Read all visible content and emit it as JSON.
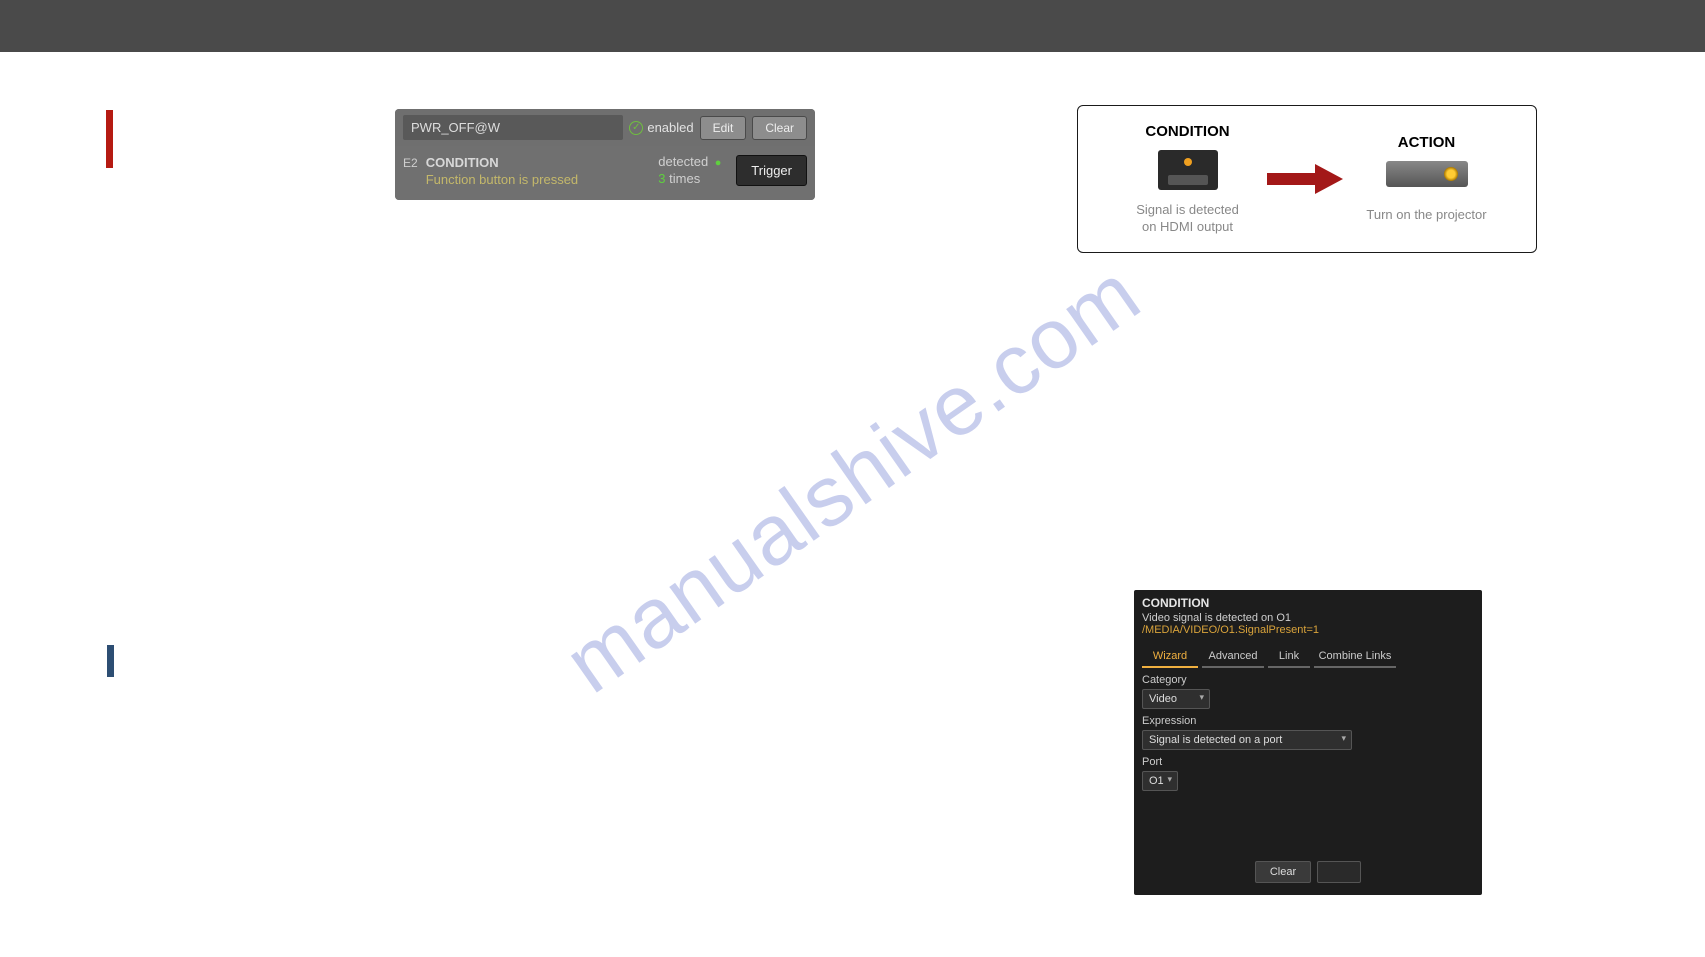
{
  "watermark": "manualshive.com",
  "event_panel": {
    "name": "PWR_OFF@W",
    "enabled_label": "enabled",
    "edit_label": "Edit",
    "clear_label": "Clear",
    "row_id": "E2",
    "condition_title": "CONDITION",
    "condition_desc": "Function button is pressed",
    "detected_label": "detected",
    "times_count": "3",
    "times_label": "times",
    "trigger_label": "Trigger"
  },
  "diagram": {
    "condition_title": "CONDITION",
    "condition_caption_l1": "Signal is detected",
    "condition_caption_l2": "on HDMI output",
    "action_title": "ACTION",
    "action_caption": "Turn on the projector"
  },
  "config": {
    "header": "CONDITION",
    "line1": "Video signal is detected on O1",
    "line2": "/MEDIA/VIDEO/O1.SignalPresent=1",
    "tabs": {
      "wizard": "Wizard",
      "advanced": "Advanced",
      "link": "Link",
      "combine": "Combine Links"
    },
    "category_label": "Category",
    "category_value": "Video",
    "expression_label": "Expression",
    "expression_value": "Signal is detected on a port",
    "port_label": "Port",
    "port_value": "O1",
    "clear_label": "Clear"
  }
}
